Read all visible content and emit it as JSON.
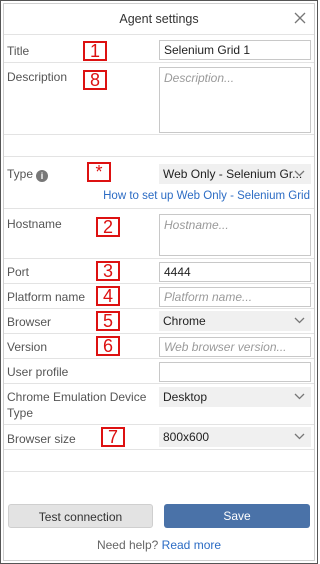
{
  "dialog": {
    "title": "Agent settings"
  },
  "fields": {
    "title": {
      "label": "Title",
      "value": "Selenium Grid 1",
      "badge": "1"
    },
    "description": {
      "label": "Description",
      "placeholder": "Description...",
      "badge": "8"
    },
    "type": {
      "label": "Type",
      "value": "Web Only - Selenium Gr...",
      "badge": "*",
      "info_icon": "info-icon"
    },
    "setup_link": "How to set up Web Only - Selenium Grid",
    "hostname": {
      "label": "Hostname",
      "placeholder": "Hostname...",
      "badge": "2"
    },
    "port": {
      "label": "Port",
      "value": "4444",
      "badge": "3"
    },
    "platform_name": {
      "label": "Platform name",
      "placeholder": "Platform name...",
      "badge": "4"
    },
    "browser": {
      "label": "Browser",
      "value": "Chrome",
      "badge": "5"
    },
    "version": {
      "label": "Version",
      "placeholder": "Web browser version...",
      "badge": "6"
    },
    "user_profile": {
      "label": "User profile",
      "value": ""
    },
    "emulation": {
      "label_line1": "Chrome Emulation Device",
      "label_line2": "Type",
      "value": "Desktop"
    },
    "browser_size": {
      "label": "Browser size",
      "value": "800x600",
      "badge": "7"
    }
  },
  "footer": {
    "test_label": "Test connection",
    "save_label": "Save",
    "help_text": "Need help?",
    "help_link": "Read more"
  },
  "colors": {
    "badge": "#dd1111",
    "link": "#2c6cc4",
    "save_button": "#4a72a8"
  }
}
